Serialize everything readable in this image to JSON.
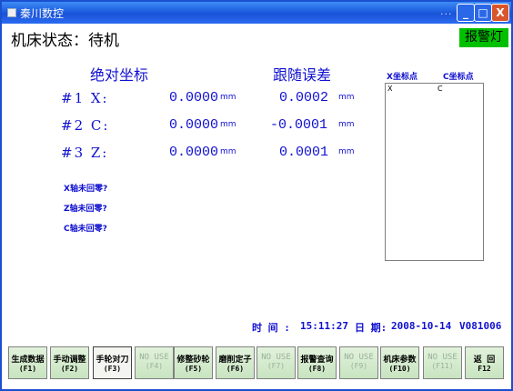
{
  "window": {
    "title": "秦川数控",
    "dots": "...",
    "min": "_",
    "max": "□",
    "close": "X"
  },
  "status": {
    "label": "机床状态：待机",
    "alarm": "报警灯"
  },
  "headers": {
    "absolute": "绝对坐标",
    "error": "跟随误差"
  },
  "axes": [
    {
      "label": "#1 X:",
      "abs": "0.0000",
      "unit": "mm",
      "err": "0.0002",
      "err_unit": "mm"
    },
    {
      "label": "#2 C:",
      "abs": "0.0000",
      "unit": "mm",
      "err": "-0.0001",
      "err_unit": "mm"
    },
    {
      "label": "#3 Z:",
      "abs": "0.0000",
      "unit": "mm",
      "err": "0.0001",
      "err_unit": "mm"
    }
  ],
  "notices": [
    "X轴未回零?",
    "Z轴未回零?",
    "C轴未回零?"
  ],
  "points": {
    "x_header": "X坐标点",
    "c_header": "C坐标点",
    "x_col": "X",
    "c_col": "C"
  },
  "footer": {
    "time_label": "时 间 :",
    "time": "15:11:27",
    "date_label": "日 期:",
    "date": "2008-10-14",
    "version": "V081006"
  },
  "fkeys": [
    {
      "l1": "生成数据",
      "l2": "(F1)",
      "state": "enabled"
    },
    {
      "l1": "手动调整",
      "l2": "(F2)",
      "state": "enabled"
    },
    {
      "l1": "手轮对刀",
      "l2": "(F3)",
      "state": "active"
    },
    {
      "l1": "NO USE",
      "l2": "(F4)",
      "state": "disabled"
    },
    {
      "l1": "修整砂轮",
      "l2": "(F5)",
      "state": "enabled"
    },
    {
      "l1": "磨削定子",
      "l2": "(F6)",
      "state": "enabled"
    },
    {
      "l1": "NO USE",
      "l2": "(F7)",
      "state": "disabled"
    },
    {
      "l1": "报警查询",
      "l2": "(F8)",
      "state": "enabled"
    },
    {
      "l1": "NO USE",
      "l2": "(F9)",
      "state": "disabled"
    },
    {
      "l1": "机床参数",
      "l2": "(F10)",
      "state": "enabled"
    },
    {
      "l1": "NO USE",
      "l2": "(F11)",
      "state": "disabled"
    },
    {
      "l1": "返 回",
      "l2": "F12",
      "state": "enabled"
    }
  ],
  "colors": {
    "title_bar": "#1e5ee0",
    "alarm": "#00c000",
    "text": "#1010d0",
    "fkey_bg": "#d4ecd0"
  }
}
